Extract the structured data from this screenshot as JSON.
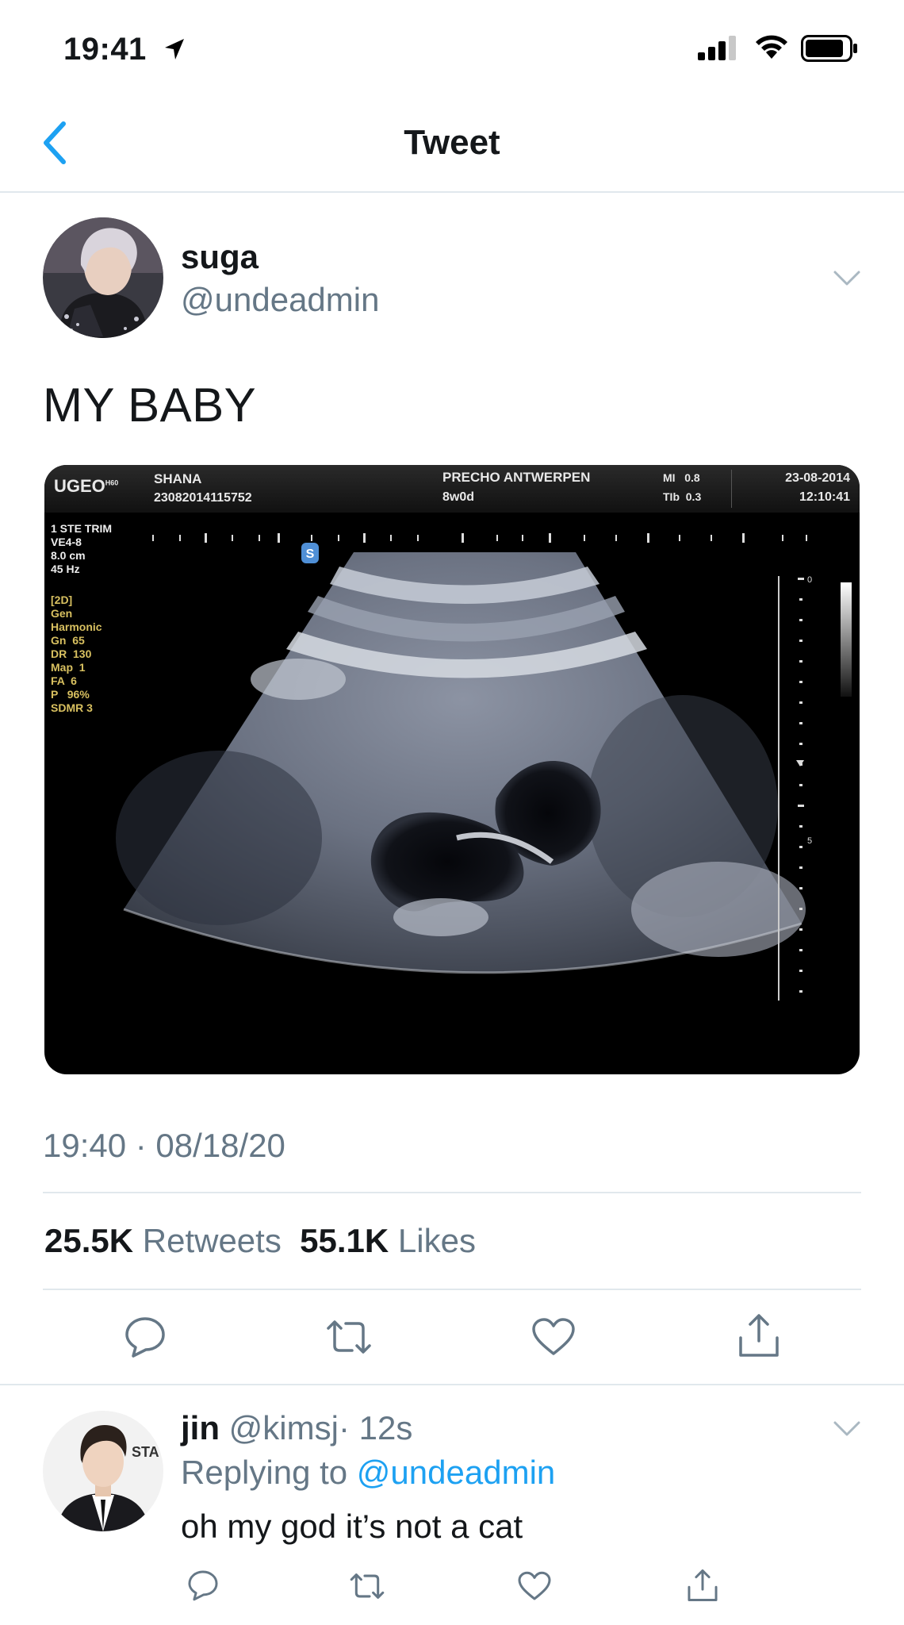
{
  "status_bar": {
    "time": "19:41"
  },
  "nav": {
    "title": "Tweet"
  },
  "tweet": {
    "author_name": "suga",
    "author_handle": "@undeadmin",
    "text": "MY BABY",
    "timestamp": "19:40 · 08/18/20",
    "retweets_count": "25.5K",
    "retweets_label": "Retweets",
    "likes_count": "55.1K",
    "likes_label": "Likes"
  },
  "ultrasound": {
    "brand": "UGEO",
    "brand_sup": "H60",
    "patient": "SHANA",
    "patient_id": "23082014115752",
    "clinic": "PRECHO ANTWERPEN",
    "ga": "8w0d",
    "mi": "MI   0.8",
    "tib": "TIb  0.3",
    "date": "23-08-2014",
    "clock": "12:10:41",
    "left_params_1": "1 STE TRIM\nVE4-8\n8.0 cm\n45 Hz",
    "left_params_2": "[2D]\nGen\nHarmonic\nGn  65\nDR  130\nMap  1\nFA  6\nP   96%\nSDMR 3",
    "scale_top": "0",
    "scale_mid": "5",
    "marker": "S"
  },
  "reply": {
    "author_name": "jin",
    "author_handle": "@kimsj",
    "time": "· 12s",
    "replying_label": "Replying to",
    "replying_handle": "@undeadmin",
    "text": "oh my god it’s not a cat",
    "avatar_badge_text": "STA"
  }
}
